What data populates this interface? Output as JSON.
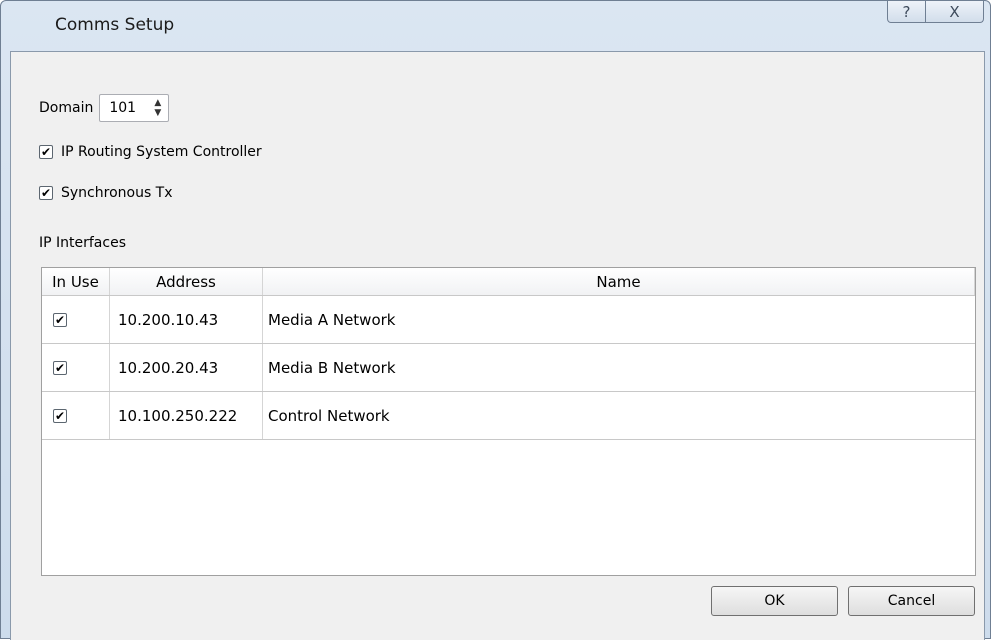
{
  "window": {
    "title": "Comms Setup",
    "help_glyph": "?",
    "close_glyph": "X"
  },
  "domain": {
    "label": "Domain",
    "value": "101"
  },
  "options": [
    {
      "label": "IP Routing System Controller",
      "checked": true
    },
    {
      "label": "Synchronous Tx",
      "checked": true
    }
  ],
  "interfaces": {
    "group_label": "IP Interfaces",
    "columns": [
      "In Use",
      "Address",
      "Name"
    ],
    "rows": [
      {
        "in_use": true,
        "check": "✔",
        "address": "10.200.10.43",
        "name": "Media A Network"
      },
      {
        "in_use": true,
        "check": "✔",
        "address": "10.200.20.43",
        "name": "Media B Network"
      },
      {
        "in_use": true,
        "check": "✔",
        "address": "10.100.250.222",
        "name": "Control Network"
      }
    ]
  },
  "buttons": {
    "ok": "OK",
    "cancel": "Cancel"
  },
  "check_glyph": "✔",
  "colors": {
    "client_bg": "#f0f0f0",
    "title_bg": "#dbe6f2"
  }
}
